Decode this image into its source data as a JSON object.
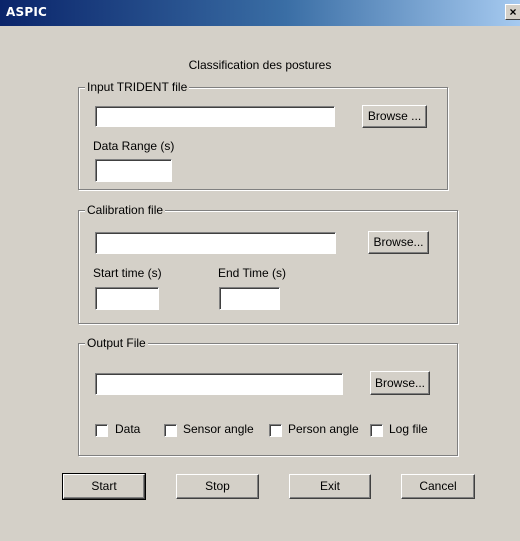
{
  "window": {
    "title": "ASPIC",
    "close_glyph": "×"
  },
  "heading": "Classification des postures",
  "input_group": {
    "legend": "Input TRIDENT file",
    "file_value": "",
    "browse_label": "Browse ...",
    "data_range_label": "Data Range (s)",
    "data_range_value": ""
  },
  "calibration_group": {
    "legend": "Calibration file",
    "file_value": "",
    "browse_label": "Browse...",
    "start_time_label": "Start time (s)",
    "start_time_value": "",
    "end_time_label": "End Time (s)",
    "end_time_value": ""
  },
  "output_group": {
    "legend": "Output File",
    "file_value": "",
    "browse_label": "Browse...",
    "checkboxes": [
      {
        "label": "Data",
        "checked": false
      },
      {
        "label": "Sensor angle",
        "checked": false
      },
      {
        "label": "Person angle",
        "checked": false
      },
      {
        "label": "Log file",
        "checked": false
      }
    ]
  },
  "actions": {
    "start_label": "Start",
    "stop_label": "Stop",
    "exit_label": "Exit",
    "cancel_label": "Cancel"
  },
  "icons": {
    "close": "close-icon"
  }
}
